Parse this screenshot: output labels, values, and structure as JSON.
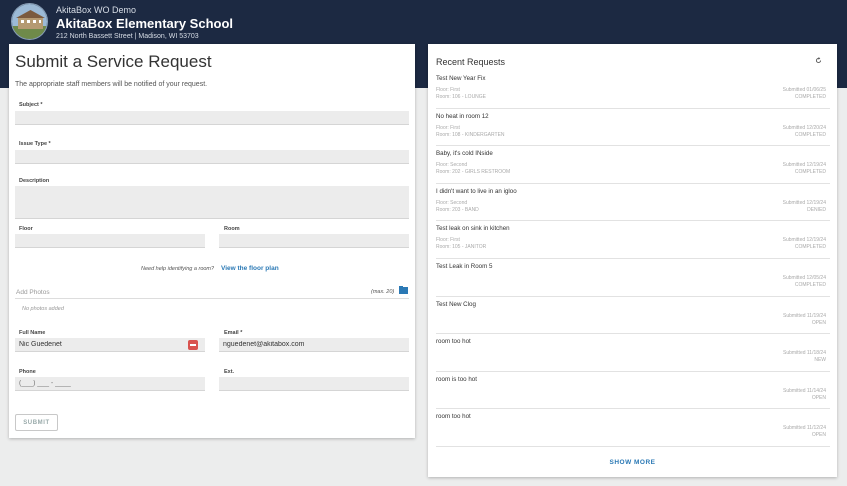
{
  "org": {
    "demo_label": "AkitaBox WO Demo",
    "name": "AkitaBox Elementary School",
    "address": "212 North Bassett Street | Madison, WI 53703"
  },
  "form": {
    "title": "Submit a Service Request",
    "subtitle": "The appropriate staff members will be notified of your request.",
    "subject_label": "Subject *",
    "issue_type_label": "Issue Type *",
    "description_label": "Description",
    "floor_label": "Floor",
    "room_label": "Room",
    "floor_help": "Need help identifying a room?",
    "floor_link": "View the floor plan",
    "photos_label": "Add Photos",
    "photos_max": "(max. 20)",
    "no_photos": "No photos added",
    "full_name_label": "Full Name",
    "full_name_value": "Nic Guedenet",
    "email_label": "Email *",
    "email_value": "nguedenet@akitabox.com",
    "phone_label": "Phone",
    "phone_placeholder": "(___) ___ - ____",
    "ext_label": "Ext.",
    "submit_label": "SUBMIT"
  },
  "recent": {
    "title": "Recent Requests",
    "show_more": "SHOW MORE",
    "items": [
      {
        "title": "Test New Year Fix",
        "floor": "Floor: First",
        "room": "Room: 106 - LOUNGE",
        "submitted": "Submitted 01/06/25",
        "status": "COMPLETED"
      },
      {
        "title": "No heat in room 12",
        "floor": "Floor: First",
        "room": "Room: 108 - KINDERGARTEN",
        "submitted": "Submitted 12/20/24",
        "status": "COMPLETED"
      },
      {
        "title": "Baby, it's cold INside",
        "floor": "Floor: Second",
        "room": "Room: 202 - GIRLS RESTROOM",
        "submitted": "Submitted 12/19/24",
        "status": "COMPLETED"
      },
      {
        "title": "I didn't want to live in an igloo",
        "floor": "Floor: Second",
        "room": "Room: 203 - BAND",
        "submitted": "Submitted 12/19/24",
        "status": "DENIED"
      },
      {
        "title": "Test leak on sink in kitchen",
        "floor": "Floor: First",
        "room": "Room: 105 - JANITOR",
        "submitted": "Submitted 12/19/24",
        "status": "COMPLETED"
      },
      {
        "title": "Test Leak in Room 5",
        "floor": "",
        "room": "",
        "submitted": "Submitted 12/05/24",
        "status": "COMPLETED"
      },
      {
        "title": "Test New Clog",
        "floor": "",
        "room": "",
        "submitted": "Submitted 11/19/24",
        "status": "OPEN"
      },
      {
        "title": "room too hot",
        "floor": "",
        "room": "",
        "submitted": "Submitted 11/18/24",
        "status": "NEW"
      },
      {
        "title": "room is too hot",
        "floor": "",
        "room": "",
        "submitted": "Submitted 11/14/24",
        "status": "OPEN"
      },
      {
        "title": "room too hot",
        "floor": "",
        "room": "",
        "submitted": "Submitted 11/12/24",
        "status": "OPEN"
      }
    ]
  },
  "colors": {
    "header_bg": "#1c2942",
    "link": "#2b79b5",
    "danger": "#d9534f"
  }
}
